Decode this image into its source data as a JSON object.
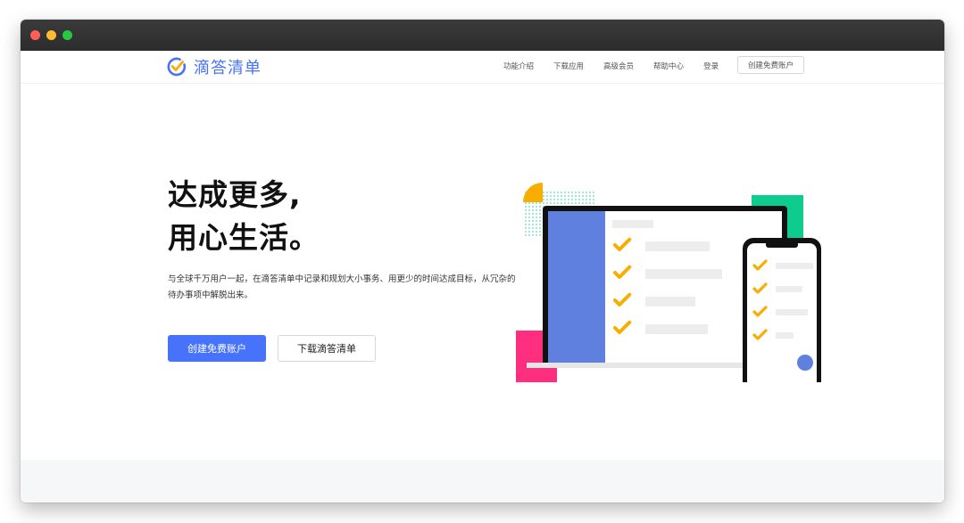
{
  "brand": {
    "name": "滴答清单",
    "accent": "#4772fa"
  },
  "nav": {
    "links": [
      "功能介绍",
      "下载应用",
      "高级会员",
      "帮助中心",
      "登录"
    ],
    "cta": "创建免费账户"
  },
  "hero": {
    "headline_line1": "达成更多,",
    "headline_line2": "用心生活。",
    "description": "与全球千万用户一起，在滴答清单中记录和规划大小事务、用更少的时间达成目标，从冗杂的待办事项中解脱出来。",
    "primary_button": "创建免费账户",
    "secondary_button": "下载滴答清单"
  },
  "illustration": {
    "colors": {
      "sidebar": "#6080e0",
      "check": "#f8ad00",
      "green": "#0ecb8e",
      "pink": "#ff2e7e",
      "dots": "#0ecb8e",
      "avatar": "#6080e0"
    },
    "laptop_tasks": 4,
    "phone_tasks": 4
  }
}
